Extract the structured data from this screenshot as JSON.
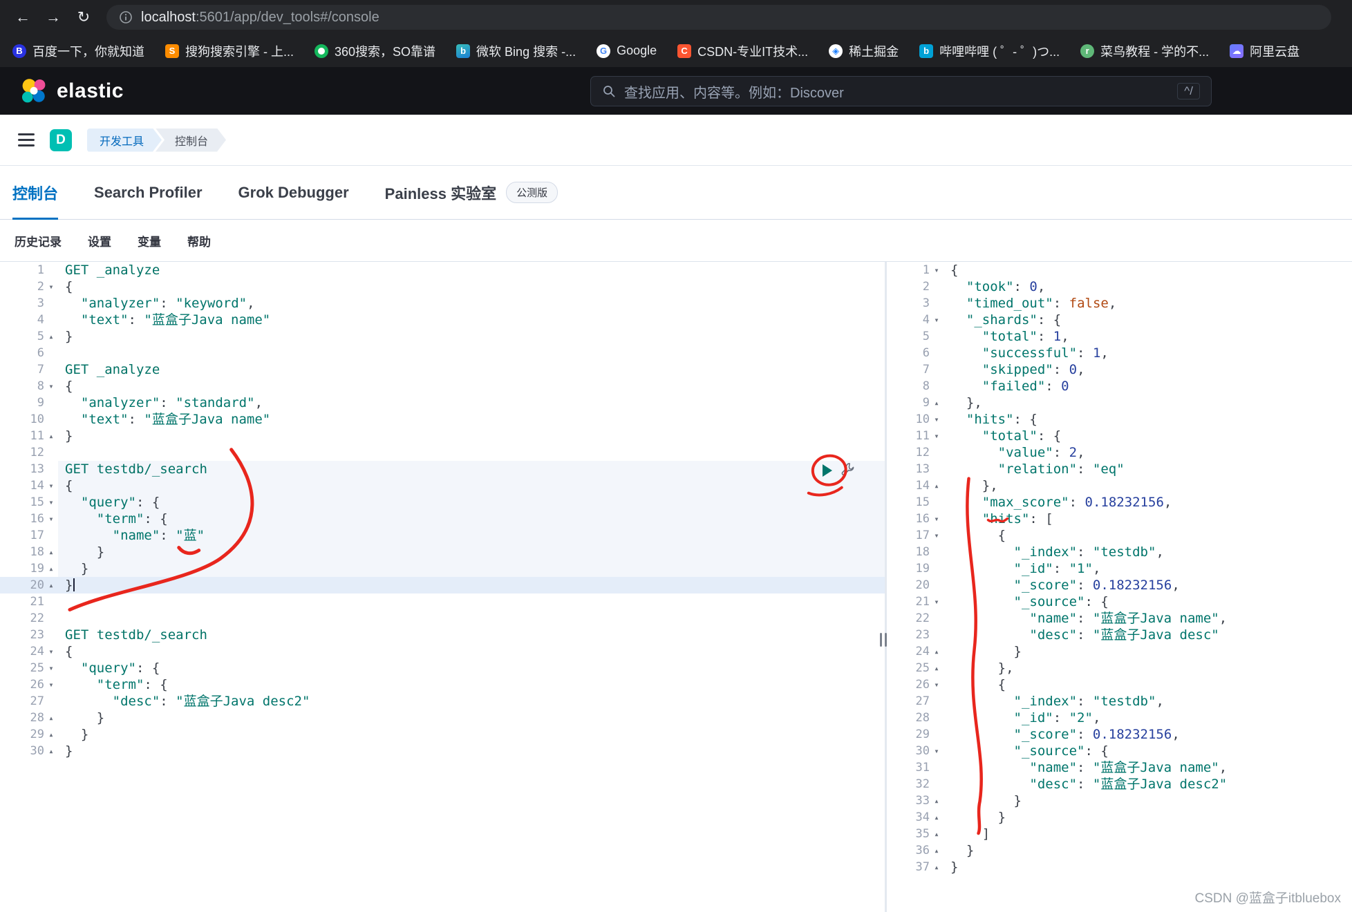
{
  "browser": {
    "icons": {
      "back": "←",
      "forward": "→",
      "reload": "↻"
    },
    "url": {
      "host": "localhost",
      "path": ":5601/app/dev_tools#/console"
    },
    "bookmarks": [
      {
        "name": "baidu",
        "label": "百度一下，你就知道",
        "glyph": "B",
        "bg": "#2932e1",
        "fg": "#ffffff",
        "round": true
      },
      {
        "name": "sogou",
        "label": "搜狗搜索引擎 - 上...",
        "glyph": "S",
        "bg": "#fd8c00",
        "fg": "#ffffff"
      },
      {
        "name": "360-search",
        "label": "360搜索，SO靠谱",
        "glyph": "",
        "bg": "#ffffff",
        "fg": "#14b75c",
        "round": true,
        "ring": "#14b75c"
      },
      {
        "name": "bing",
        "label": "微软 Bing 搜索 -...",
        "glyph": "b",
        "bg": "linear-gradient(160deg,#37bdb8,#1b7fd4)",
        "fg": "#ffffff"
      },
      {
        "name": "google",
        "label": "Google",
        "glyph": "G",
        "bg": "#ffffff",
        "fg": "#4285f4",
        "round": true
      },
      {
        "name": "csdn",
        "label": "CSDN-专业IT技术...",
        "glyph": "C",
        "bg": "#fc5531",
        "fg": "#ffffff"
      },
      {
        "name": "juejin",
        "label": "稀土掘金",
        "glyph": "◈",
        "bg": "#ffffff",
        "fg": "#1e80ff",
        "round": true
      },
      {
        "name": "bilibili",
        "label": "哔哩哔哩 ( ゜- ゜)つ...",
        "glyph": "b",
        "bg": "#00a1d6",
        "fg": "#ffffff"
      },
      {
        "name": "runoob",
        "label": "菜鸟教程 - 学的不...",
        "glyph": "r",
        "bg": "#5fb878",
        "fg": "#ffffff",
        "round": true
      },
      {
        "name": "aliyun-drive",
        "label": "阿里云盘",
        "glyph": "☁",
        "bg": "linear-gradient(145deg,#637dff,#8a6dff)",
        "fg": "#ffffff"
      }
    ]
  },
  "elastic_header": {
    "brand": "elastic",
    "search_placeholder": "查找应用、内容等。例如：Discover",
    "shortcut": "^/"
  },
  "nav": {
    "space_badge": "D",
    "breadcrumbs": [
      {
        "name": "dev-tools",
        "label": "开发工具"
      },
      {
        "name": "console",
        "label": "控制台"
      }
    ]
  },
  "tabs": [
    {
      "name": "console",
      "label": "控制台",
      "active": true
    },
    {
      "name": "search-profiler",
      "label": "Search Profiler",
      "active": false
    },
    {
      "name": "grok-debugger",
      "label": "Grok Debugger",
      "active": false
    },
    {
      "name": "painless-lab",
      "label": "Painless 实验室",
      "active": false,
      "badge": "公测版"
    }
  ],
  "console_menu": [
    {
      "name": "history",
      "label": "历史记录"
    },
    {
      "name": "settings",
      "label": "设置"
    },
    {
      "name": "variables",
      "label": "变量"
    },
    {
      "name": "help",
      "label": "帮助"
    }
  ],
  "editor": {
    "request": {
      "active_from": 13,
      "active_to": 20,
      "cursor_line": 20,
      "lines": [
        "GET _analyze",
        "{",
        "  \"analyzer\": \"keyword\",",
        "  \"text\": \"蓝盒子Java name\"",
        "}",
        "",
        "GET _analyze",
        "{",
        "  \"analyzer\": \"standard\",",
        "  \"text\": \"蓝盒子Java name\"",
        "}",
        "",
        "GET testdb/_search",
        "{",
        "  \"query\": {",
        "    \"term\": {",
        "      \"name\": \"蓝\"",
        "    }",
        "  }",
        "}",
        "",
        "",
        "GET testdb/_search",
        "{",
        "  \"query\": {",
        "    \"term\": {",
        "      \"desc\": \"蓝盒子Java desc2\"",
        "    }",
        "  }",
        "}"
      ]
    },
    "response": {
      "lines": [
        "{",
        "  \"took\": 0,",
        "  \"timed_out\": false,",
        "  \"_shards\": {",
        "    \"total\": 1,",
        "    \"successful\": 1,",
        "    \"skipped\": 0,",
        "    \"failed\": 0",
        "  },",
        "  \"hits\": {",
        "    \"total\": {",
        "      \"value\": 2,",
        "      \"relation\": \"eq\"",
        "    },",
        "    \"max_score\": 0.18232156,",
        "    \"hits\": [",
        "      {",
        "        \"_index\": \"testdb\",",
        "        \"_id\": \"1\",",
        "        \"_score\": 0.18232156,",
        "        \"_source\": {",
        "          \"name\": \"蓝盒子Java name\",",
        "          \"desc\": \"蓝盒子Java desc\"",
        "        }",
        "      },",
        "      {",
        "        \"_index\": \"testdb\",",
        "        \"_id\": \"2\",",
        "        \"_score\": 0.18232156,",
        "        \"_source\": {",
        "          \"name\": \"蓝盒子Java name\",",
        "          \"desc\": \"蓝盒子Java desc2\"",
        "        }",
        "      }",
        "    ]",
        "  }",
        "}"
      ]
    }
  },
  "watermark": "CSDN @蓝盒子itbluebox",
  "colors": {
    "accent_blue": "#0071c2",
    "space_teal": "#00bfb3",
    "code_string": "#00756b",
    "code_number": "#27409e",
    "code_boolean": "#b14912",
    "play_green": "#00756b",
    "annotation_red": "#e8261d"
  }
}
